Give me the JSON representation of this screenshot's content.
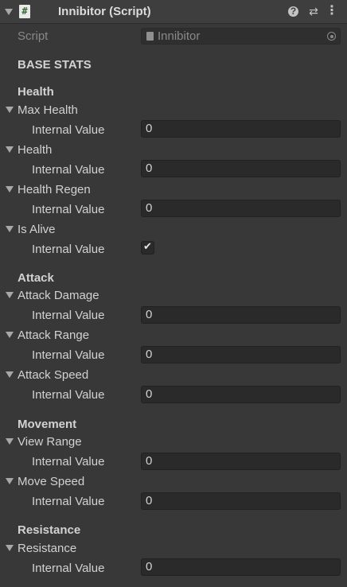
{
  "header": {
    "title": "Innibitor (Script)",
    "script_icon_glyph": "#",
    "help_icon": "?",
    "presets_icon": "⇄",
    "menu_icon": "⋮"
  },
  "script_row": {
    "label": "Script",
    "value": "Innibitor"
  },
  "base_stats_title": "BASE STATS",
  "sections": {
    "health": {
      "title": "Health",
      "max_health": {
        "label": "Max Health",
        "sub_label": "Internal Value",
        "value": "0"
      },
      "health": {
        "label": "Health",
        "sub_label": "Internal Value",
        "value": "0"
      },
      "health_regen": {
        "label": "Health Regen",
        "sub_label": "Internal Value",
        "value": "0"
      },
      "is_alive": {
        "label": "Is Alive",
        "sub_label": "Internal Value",
        "checked": true,
        "check_glyph": "✔"
      }
    },
    "attack": {
      "title": "Attack",
      "attack_damage": {
        "label": "Attack Damage",
        "sub_label": "Internal Value",
        "value": "0"
      },
      "attack_range": {
        "label": "Attack Range",
        "sub_label": "Internal Value",
        "value": "0"
      },
      "attack_speed": {
        "label": "Attack Speed",
        "sub_label": "Internal Value",
        "value": "0"
      }
    },
    "movement": {
      "title": "Movement",
      "view_range": {
        "label": "View Range",
        "sub_label": "Internal Value",
        "value": "0"
      },
      "move_speed": {
        "label": "Move Speed",
        "sub_label": "Internal Value",
        "value": "0"
      }
    },
    "resistance": {
      "title": "Resistance",
      "resistance": {
        "label": "Resistance",
        "sub_label": "Internal Value",
        "value": "0"
      }
    }
  },
  "colors": {
    "background": "#383838",
    "header": "#3e3e3e",
    "field": "#2a2a2a",
    "text": "#d2d2d2",
    "disabled_text": "#888888"
  }
}
